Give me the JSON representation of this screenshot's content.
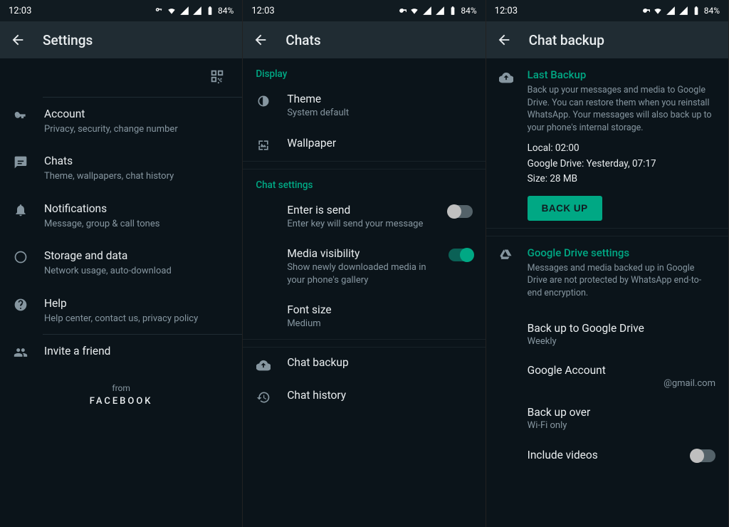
{
  "status": {
    "time": "12:03",
    "battery": "84%"
  },
  "screen1": {
    "title": "Settings",
    "items": [
      {
        "title": "Account",
        "sub": "Privacy, security, change number"
      },
      {
        "title": "Chats",
        "sub": "Theme, wallpapers, chat history"
      },
      {
        "title": "Notifications",
        "sub": "Message, group & call tones"
      },
      {
        "title": "Storage and data",
        "sub": "Network usage, auto-download"
      },
      {
        "title": "Help",
        "sub": "Help center, contact us, privacy policy"
      },
      {
        "title": "Invite a friend",
        "sub": ""
      }
    ],
    "from": "from",
    "facebook": "FACEBOOK"
  },
  "screen2": {
    "title": "Chats",
    "display_header": "Display",
    "theme": {
      "title": "Theme",
      "sub": "System default"
    },
    "wallpaper": "Wallpaper",
    "chat_settings_header": "Chat settings",
    "enter_send": {
      "title": "Enter is send",
      "sub": "Enter key will send your message"
    },
    "media_vis": {
      "title": "Media visibility",
      "sub": "Show newly downloaded media in your phone's gallery"
    },
    "font_size": {
      "title": "Font size",
      "sub": "Medium"
    },
    "chat_backup": "Chat backup",
    "chat_history": "Chat history"
  },
  "screen3": {
    "title": "Chat backup",
    "last_backup_title": "Last Backup",
    "last_backup_desc": "Back up your messages and media to Google Drive. You can restore them when you reinstall WhatsApp. Your messages will also back up to your phone's internal storage.",
    "local": "Local: 02:00",
    "gdrive": "Google Drive: Yesterday, 07:17",
    "size": "Size: 28 MB",
    "backup_button": "BACK UP",
    "gd_title": "Google Drive settings",
    "gd_desc": "Messages and media backed up in Google Drive are not protected by WhatsApp end-to-end encryption.",
    "freq": {
      "title": "Back up to Google Drive",
      "sub": "Weekly"
    },
    "account": {
      "title": "Google Account",
      "sub": "@gmail.com"
    },
    "over": {
      "title": "Back up over",
      "sub": "Wi-Fi only"
    },
    "include_videos": "Include videos"
  }
}
